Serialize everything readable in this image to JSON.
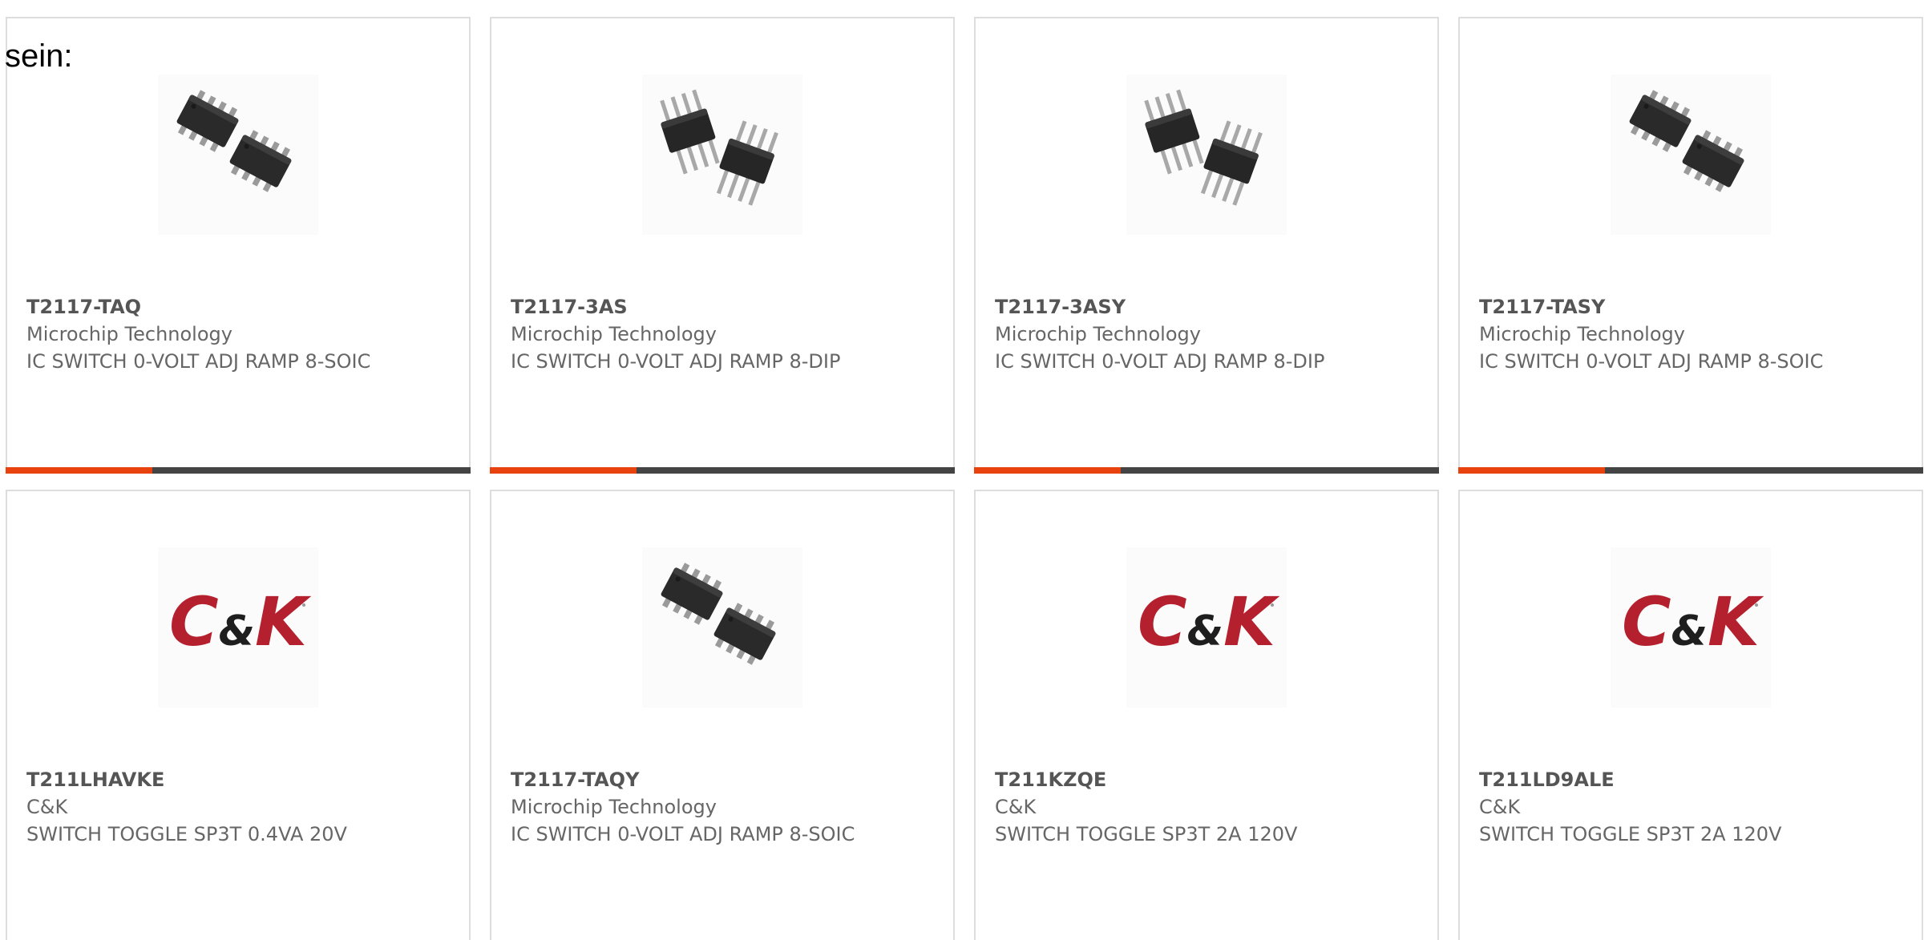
{
  "intro_text": "sein:",
  "colors": {
    "accent": "#e8430f",
    "bar": "#444444",
    "ck_red": "#b5202e",
    "ck_dark": "#1e1e1e"
  },
  "products": [
    {
      "part": "T2117-TAQ",
      "manufacturer": "Microchip Technology",
      "description": "IC SWITCH 0-VOLT ADJ RAMP 8-SOIC",
      "image": "soic-chip-icon"
    },
    {
      "part": "T2117-3AS",
      "manufacturer": "Microchip Technology",
      "description": "IC SWITCH 0-VOLT ADJ RAMP 8-DIP",
      "image": "dip-chip-icon"
    },
    {
      "part": "T2117-3ASY",
      "manufacturer": "Microchip Technology",
      "description": "IC SWITCH 0-VOLT ADJ RAMP 8-DIP",
      "image": "dip-chip-icon"
    },
    {
      "part": "T2117-TASY",
      "manufacturer": "Microchip Technology",
      "description": "IC SWITCH 0-VOLT ADJ RAMP 8-SOIC",
      "image": "soic-chip-icon"
    },
    {
      "part": "T211LHAVKE",
      "manufacturer": "C&K",
      "description": "SWITCH TOGGLE SP3T 0.4VA 20V",
      "image": "ck-logo"
    },
    {
      "part": "T2117-TAQY",
      "manufacturer": "Microchip Technology",
      "description": "IC SWITCH 0-VOLT ADJ RAMP 8-SOIC",
      "image": "soic-chip-icon"
    },
    {
      "part": "T211KZQE",
      "manufacturer": "C&K",
      "description": "SWITCH TOGGLE SP3T 2A 120V",
      "image": "ck-logo"
    },
    {
      "part": "T211LD9ALE",
      "manufacturer": "C&K",
      "description": "SWITCH TOGGLE SP3T 2A 120V",
      "image": "ck-logo"
    }
  ],
  "ck_logo_text": "C&K"
}
